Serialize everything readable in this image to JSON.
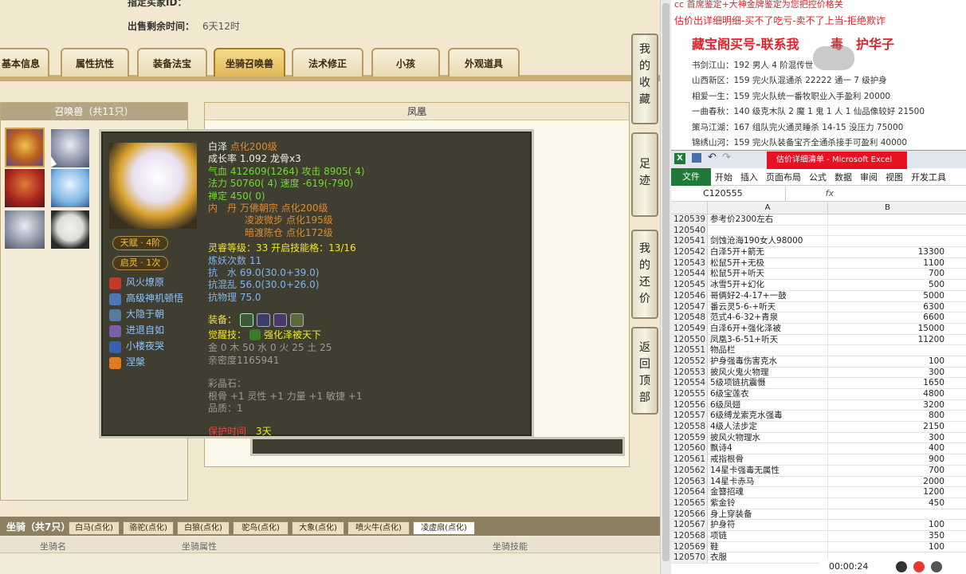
{
  "header": {
    "designated_buyer": "指定买家ID：",
    "remaining_label": "出售剩余时间：",
    "remaining_value": "6天12时"
  },
  "tabs": [
    "基本信息",
    "属性抗性",
    "装备法宝",
    "坐骑召唤兽",
    "法术修正",
    "小孩",
    "外观道具"
  ],
  "summon_panel": {
    "title": "召唤兽（共11只）",
    "right_title": "凤凰"
  },
  "side_rail": [
    {
      "label": "我的收藏"
    },
    {
      "label": "足迹"
    },
    {
      "label": "我的还价"
    },
    {
      "label": "返回顶部"
    }
  ],
  "tooltip": {
    "name": "白泽",
    "name_level": "点化200级",
    "growth": "成长率 1.092 龙骨x3",
    "hp": "气血 412609(1264) 攻击 8905( 4)",
    "mp": "法力 50760( 4) 速度 -619(-790)",
    "ding": "禅定 450( 0)",
    "dan1": "内　丹 万佛朝宗 点化200级",
    "dan2": "凌波微步 点化195级",
    "dan3": "暗渡陈仓 点化172级",
    "lingshou": "灵睿等级：33 开启技能格：13/16",
    "lianyao": "炼妖次数 11",
    "kang_shui": "抗　水 69.0(30.0+39.0)",
    "kang_hun": "抗混乱 56.0(30.0+26.0)",
    "kang_wu": "抗物理 75.0",
    "equip_label": "装备：",
    "awaken": "觉醒技：",
    "awaken_skill": "强化泽被天下",
    "elements": "金 0 木 50 水 0 火 25 土 25",
    "intimacy": "亲密度1165941",
    "caijing": "彩晶石：",
    "caijing_attrs": "根骨 +1 灵性 +1 力量 +1 敏捷 +1",
    "pinzhi": "品质：1",
    "protect": "保护时间",
    "protect_value": "3天",
    "talent": "天赋 · 4阶",
    "qiling": "启灵 · 1次",
    "skills": [
      "风火燎原",
      "高级神机顿悟",
      "大隐于朝",
      "进退自如",
      "小楼夜哭",
      "涅槃"
    ]
  },
  "bottom": {
    "mount_label": "坐骑（共7只）",
    "mount_tabs": [
      "白马(点化)",
      "骆驼(点化)",
      "白狼(点化)",
      "驼鸟(点化)",
      "大象(点化)",
      "喷火牛(点化)",
      "凌虚扇(点化)"
    ],
    "col_name": "坐骑名",
    "col_attr": "坐骑属性",
    "col_skill": "坐骑技能"
  },
  "notes": {
    "line1": "cc 首席鉴定+大神金牌鉴定为您把控价格关",
    "line2": "估价出详细明细-买不了吃亏-卖不了上当-拒绝欺诈",
    "title": "藏宝阁买号-联系我",
    "title_tail": "毒　护华子",
    "items": [
      "书剑江山：192 男人 4 阶混传世",
      "山西新区：159 完火队混通杀 22222 通一 7 级护身",
      "相爱一生：159 完火队统一番牧职业入手盈利 20000",
      "一曲春秋：140 级克木队 2 魔 1 鬼 1 人 1 仙品像较好 21500",
      "策马江湖：167 组队完火通灵睡杀 14-15 没压力 75000",
      "锦绣山河：159 完火队装备宝齐全通杀接手可盈利 40000"
    ]
  },
  "excel": {
    "title": "估价详细清单 - Microsoft Excel",
    "ribbon": [
      "文件",
      "开始",
      "插入",
      "页面布局",
      "公式",
      "数据",
      "审阅",
      "视图",
      "开发工具"
    ],
    "namebox": "C120555",
    "fx": "fx",
    "col_a": "A",
    "col_b": "B",
    "rows": [
      {
        "n": "120539",
        "a": "参考价2300左右",
        "b": ""
      },
      {
        "n": "120540",
        "a": "",
        "b": ""
      },
      {
        "n": "120541",
        "a": "剑蚀沧海190女人98000",
        "b": ""
      },
      {
        "n": "120542",
        "a": "白泽5开+箭无",
        "b": "13300"
      },
      {
        "n": "120543",
        "a": "松鼠5开+无极",
        "b": "1100"
      },
      {
        "n": "120544",
        "a": "松鼠5开+听天",
        "b": "700"
      },
      {
        "n": "120545",
        "a": "冰雪5开+幻化",
        "b": "500"
      },
      {
        "n": "120546",
        "a": "哥俩好2-4-17+一鼓",
        "b": "5000"
      },
      {
        "n": "120547",
        "a": "番云灵5-6-+听天",
        "b": "6300"
      },
      {
        "n": "120548",
        "a": "范式4-6-32+青泉",
        "b": "6600"
      },
      {
        "n": "120549",
        "a": "白泽6开+强化泽被",
        "b": "15000"
      },
      {
        "n": "120550",
        "a": "凤凰3-6-51+听天",
        "b": "11200"
      },
      {
        "n": "120551",
        "a": "物品栏",
        "b": ""
      },
      {
        "n": "120552",
        "a": "护身强毒伤害克水",
        "b": "100"
      },
      {
        "n": "120553",
        "a": "披风火鬼火物理",
        "b": "300"
      },
      {
        "n": "120554",
        "a": "5级项链抗震慑",
        "b": "1650"
      },
      {
        "n": "120555",
        "a": "6级宝莲衣",
        "b": "4800"
      },
      {
        "n": "120556",
        "a": "6级凤翅",
        "b": "3200"
      },
      {
        "n": "120557",
        "a": "6级缚龙索克水强毒",
        "b": "800"
      },
      {
        "n": "120558",
        "a": "4级人法步定",
        "b": "2150"
      },
      {
        "n": "120559",
        "a": "披风火物理水",
        "b": "300"
      },
      {
        "n": "120560",
        "a": "飘诗4",
        "b": "400"
      },
      {
        "n": "120561",
        "a": "戒指根骨",
        "b": "900"
      },
      {
        "n": "120562",
        "a": "14星卡强毒无属性",
        "b": "700"
      },
      {
        "n": "120563",
        "a": "14星卡赤马",
        "b": "2000"
      },
      {
        "n": "120564",
        "a": "金簪招魂",
        "b": "1200"
      },
      {
        "n": "120565",
        "a": "紫金铃",
        "b": "450"
      },
      {
        "n": "120566",
        "a": "身上穿装备",
        "b": ""
      },
      {
        "n": "120567",
        "a": "护身符",
        "b": "100"
      },
      {
        "n": "120568",
        "a": "项链",
        "b": "350"
      },
      {
        "n": "120569",
        "a": "鞋",
        "b": "100"
      },
      {
        "n": "120570",
        "a": "衣服",
        "b": ""
      }
    ]
  },
  "recorder": {
    "time": "00:00:24"
  }
}
